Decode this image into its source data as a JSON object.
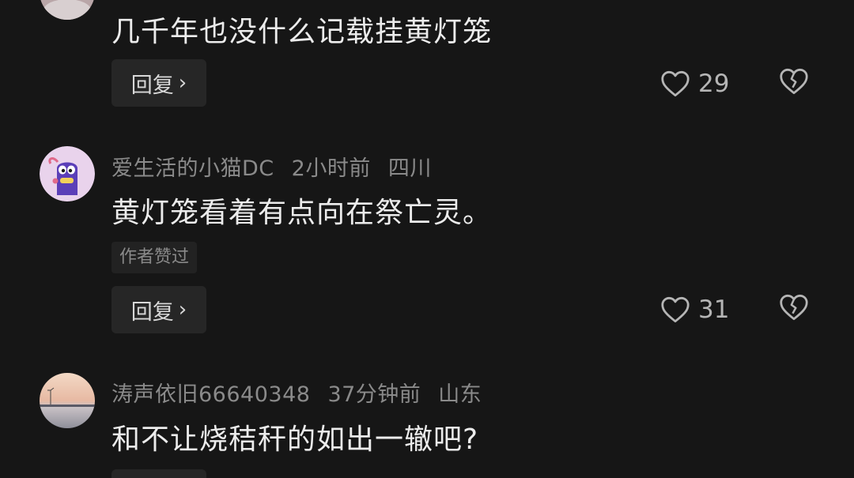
{
  "comments": [
    {
      "text": "几千年也没什么记载挂黄灯笼",
      "reply_label": "回复",
      "reply_chevron": "›",
      "like_count": "29"
    },
    {
      "username": "爱生活的小猫DC",
      "time": "2小时前",
      "location": "四川",
      "text": "黄灯笼看着有点向在祭亡灵。",
      "author_badge": "作者赞过",
      "reply_label": "回复",
      "reply_chevron": "›",
      "like_count": "31"
    },
    {
      "username": "涛声依旧66640348",
      "time": "37分钟前",
      "location": "山东",
      "text": "和不让烧秸秆的如出一辙吧?"
    }
  ],
  "icons": {
    "like": "heart-outline-icon",
    "dislike": "broken-heart-icon"
  },
  "colors": {
    "background": "#161616",
    "text_primary": "#ececec",
    "text_secondary": "#8a8a8a",
    "button_bg": "#262626"
  }
}
